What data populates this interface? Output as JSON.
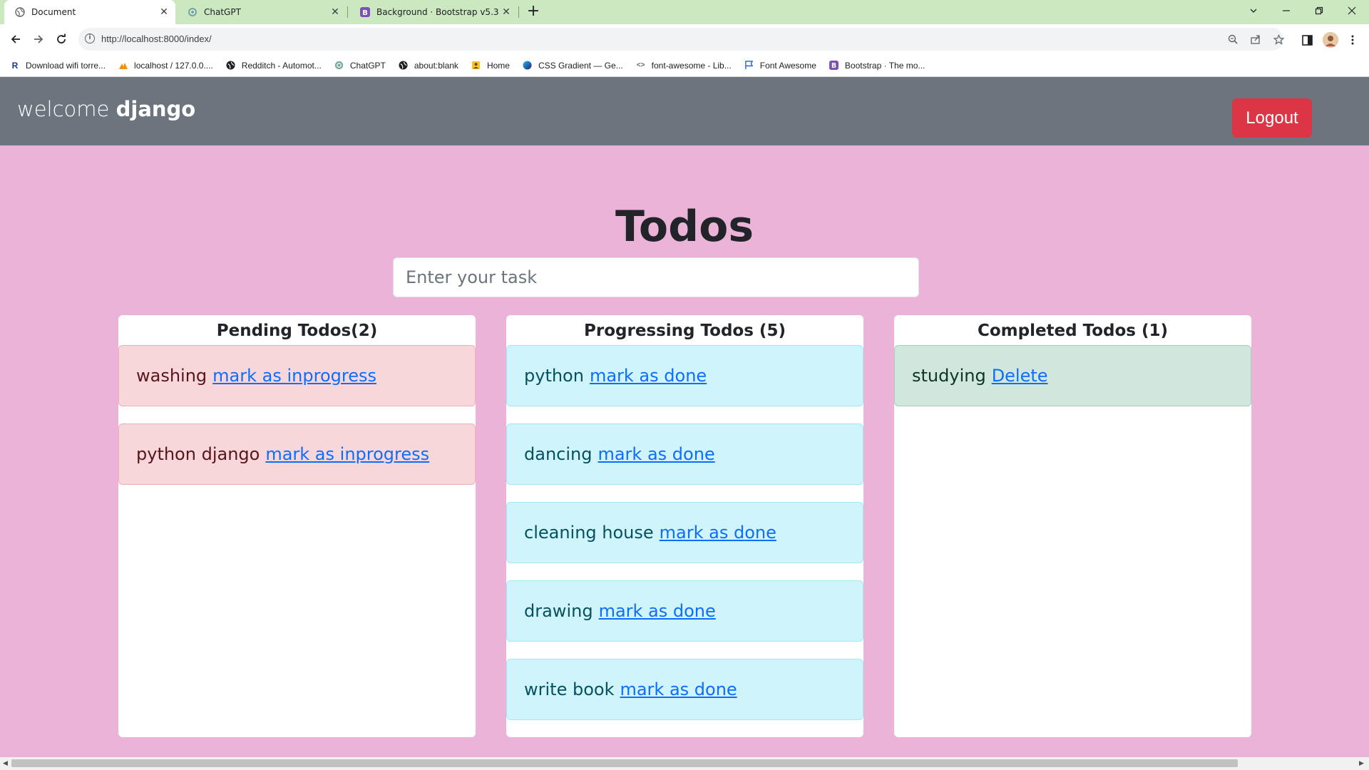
{
  "browser": {
    "tabs": [
      {
        "title": "Document",
        "icon": "globe-icon",
        "active": true
      },
      {
        "title": "ChatGPT",
        "icon": "chatgpt-icon",
        "active": false
      },
      {
        "title": "Background · Bootstrap v5.3",
        "icon": "bootstrap-icon",
        "active": false
      }
    ],
    "new_tab_label": "+",
    "url": "http://localhost:8000/index/",
    "bookmarks": [
      {
        "label": "Download wifi torre...",
        "icon": "r-icon"
      },
      {
        "label": "localhost / 127.0.0....",
        "icon": "phpmyadmin-icon"
      },
      {
        "label": "Redditch - Automot...",
        "icon": "globe-icon"
      },
      {
        "label": "ChatGPT",
        "icon": "chatgpt-icon"
      },
      {
        "label": "about:blank",
        "icon": "globe-icon"
      },
      {
        "label": "Home",
        "icon": "home-icon"
      },
      {
        "label": "CSS Gradient — Ge...",
        "icon": "gradient-icon"
      },
      {
        "label": "font-awesome - Lib...",
        "icon": "code-icon"
      },
      {
        "label": "Font Awesome",
        "icon": "flag-icon"
      },
      {
        "label": "Bootstrap · The mo...",
        "icon": "bootstrap-icon"
      }
    ]
  },
  "navbar": {
    "welcome": "welcome",
    "username": "django",
    "logout_label": "Logout"
  },
  "page": {
    "title": "Todos",
    "task_placeholder": "Enter your task"
  },
  "columns": {
    "pending": {
      "heading": "Pending Todos(2)",
      "items": [
        {
          "task": "washing",
          "action": "mark as inprogress"
        },
        {
          "task": "python django",
          "action": "mark as inprogress"
        }
      ]
    },
    "progressing": {
      "heading": "Progressing Todos (5)",
      "items": [
        {
          "task": "python",
          "action": "mark as done"
        },
        {
          "task": "dancing",
          "action": "mark as done"
        },
        {
          "task": "cleaning house",
          "action": "mark as done"
        },
        {
          "task": "drawing",
          "action": "mark as done"
        },
        {
          "task": "write book",
          "action": "mark as done"
        }
      ]
    },
    "completed": {
      "heading": "Completed Todos (1)",
      "items": [
        {
          "task": "studying",
          "action": "Delete"
        }
      ]
    }
  },
  "colors": {
    "page_bg": "#ecb3d9",
    "navbar_bg": "#6c757d",
    "logout_bg": "#dc3545",
    "tabstrip_bg": "#cbe8c0"
  }
}
